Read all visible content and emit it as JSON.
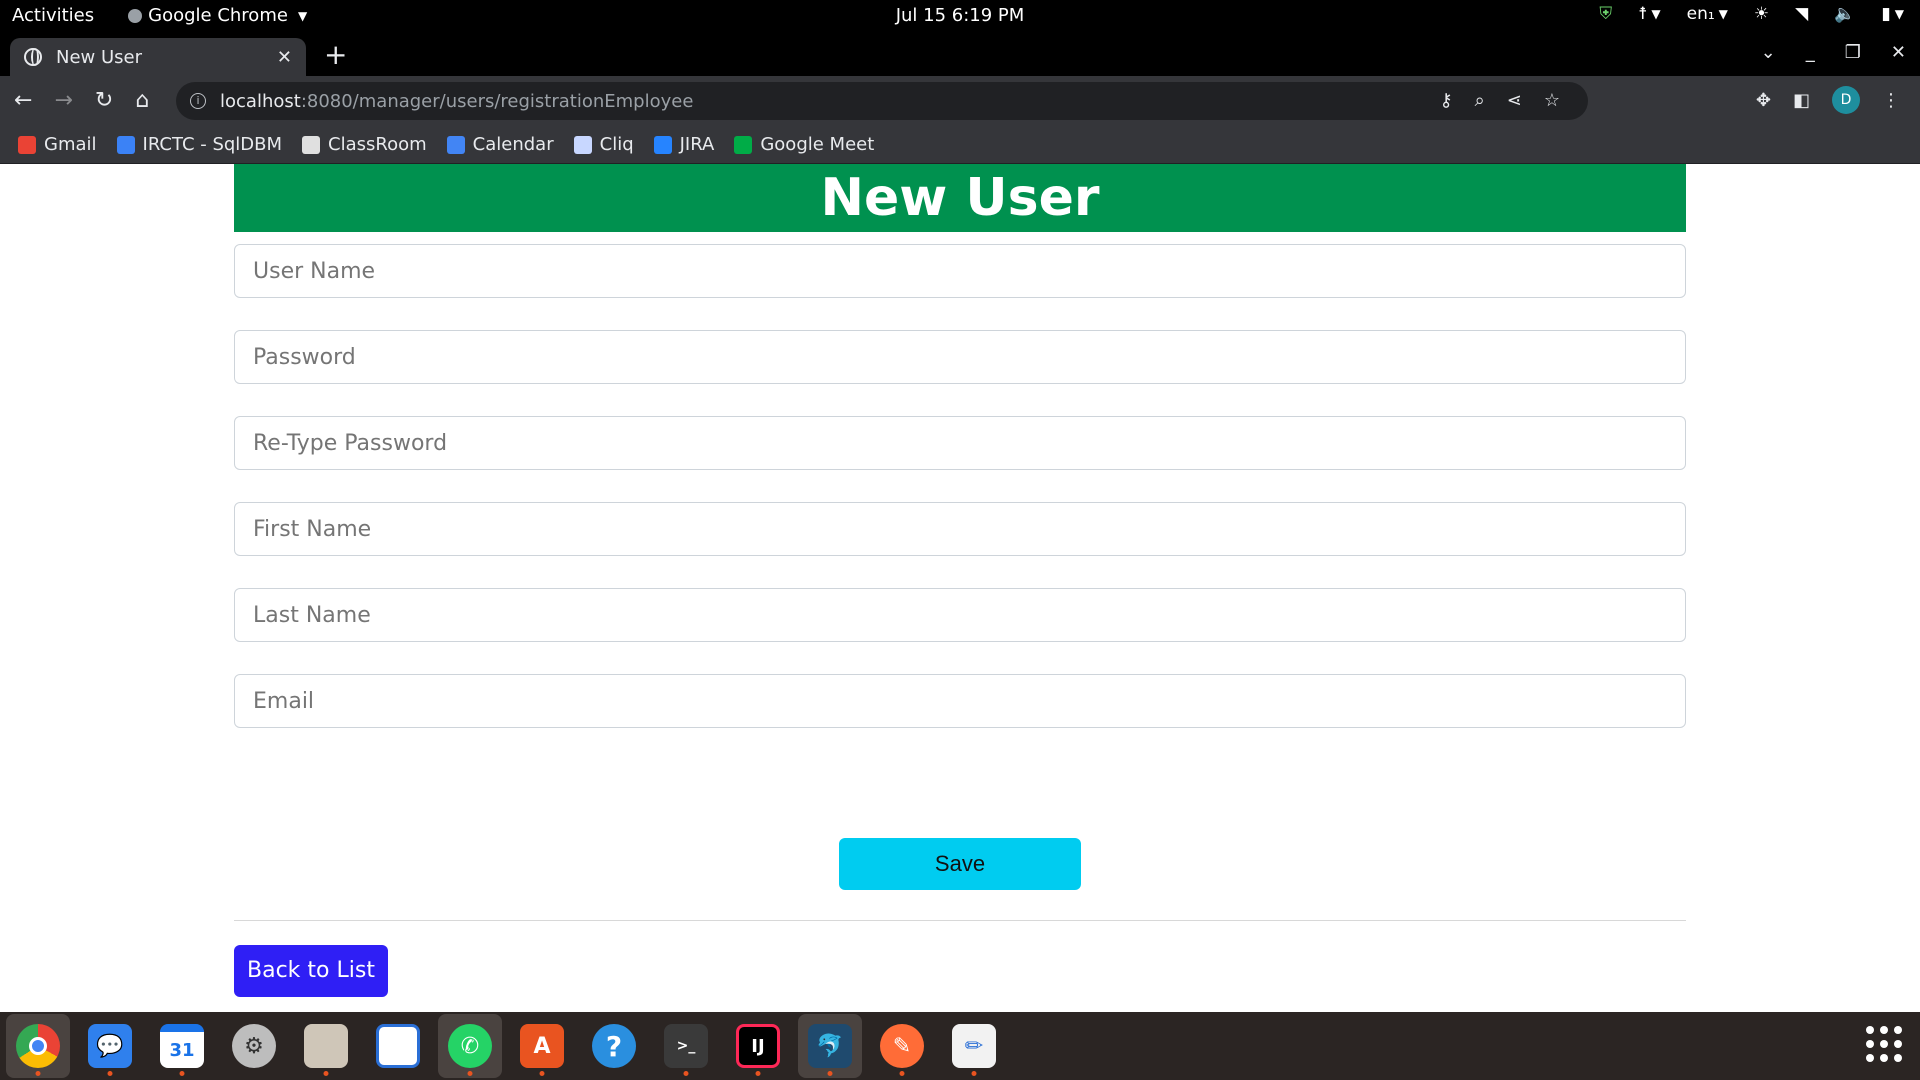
{
  "topbar": {
    "activities": "Activities",
    "app_name": "Google Chrome",
    "clock": "Jul 15  6:19 PM",
    "lang": "en₁"
  },
  "browser": {
    "tab_title": "New User",
    "url_host": "localhost",
    "url_path": ":8080/manager/users/registrationEmployee",
    "profile_initial": "D"
  },
  "bookmarks": [
    {
      "label": "Gmail",
      "color": "#ea4335"
    },
    {
      "label": "IRCTC - SqlDBM",
      "color": "#3b82f6"
    },
    {
      "label": "ClassRoom",
      "color": "#e0e0e0"
    },
    {
      "label": "Calendar",
      "color": "#4285f4"
    },
    {
      "label": "Cliq",
      "color": "#c8d7ff"
    },
    {
      "label": "JIRA",
      "color": "#2684ff"
    },
    {
      "label": "Google Meet",
      "color": "#00ac47"
    }
  ],
  "form": {
    "header": "New User",
    "fields": {
      "username": "User Name",
      "password": "Password",
      "retype": "Re-Type Password",
      "firstname": "First Name",
      "lastname": "Last Name",
      "email": "Email"
    },
    "save_label": "Save",
    "back_label": "Back to List"
  },
  "colors": {
    "header_bg": "#00914f",
    "save_bg": "#00ccf0",
    "back_bg": "#2f1ff5"
  },
  "dock": {
    "calendar_day": "31",
    "intellij": "IJ"
  }
}
